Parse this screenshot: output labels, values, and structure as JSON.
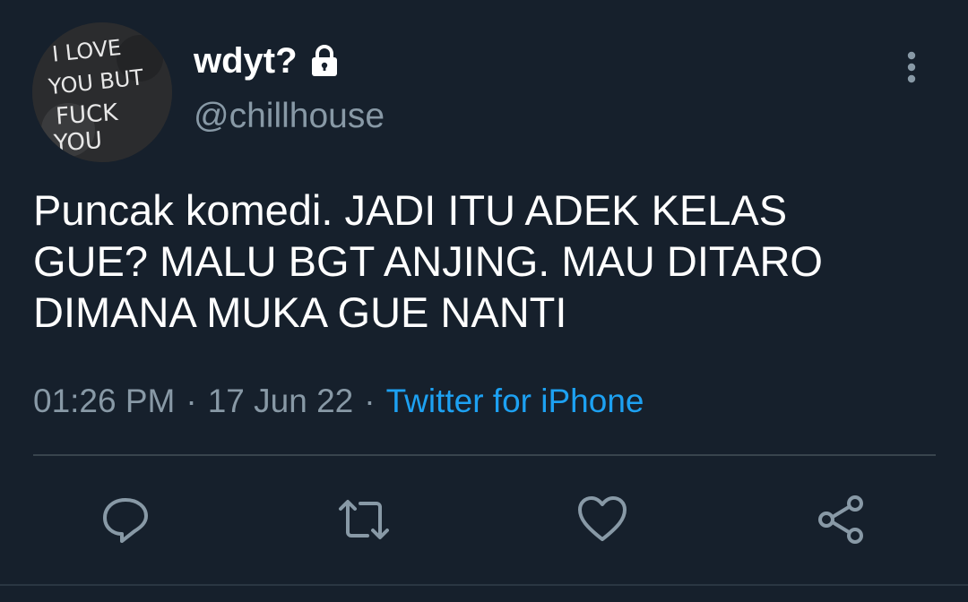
{
  "tweet": {
    "display_name": "wdyt?",
    "handle": "@chillhouse",
    "text": "Puncak komedi. JADI ITU ADEK KELAS\nGUE? MALU BGT ANJING. MAU DITARO\nDIMANA MUKA GUE NANTI",
    "time": "01:26 PM",
    "date": "17 Jun 22",
    "separator": "·",
    "source": "Twitter for iPhone",
    "avatar_text": [
      "I LOVE",
      "YOU BUT",
      "FUCK",
      "YOU"
    ],
    "icons": {
      "lock": "lock-icon",
      "more": "more-vertical-icon",
      "reply": "reply-icon",
      "retweet": "retweet-icon",
      "like": "heart-icon",
      "share": "share-icon"
    }
  },
  "colors": {
    "background": "#16202c",
    "primary_text": "#ffffff",
    "secondary_text": "#8899a6",
    "link": "#1da1f2",
    "divider": "#38444d"
  }
}
